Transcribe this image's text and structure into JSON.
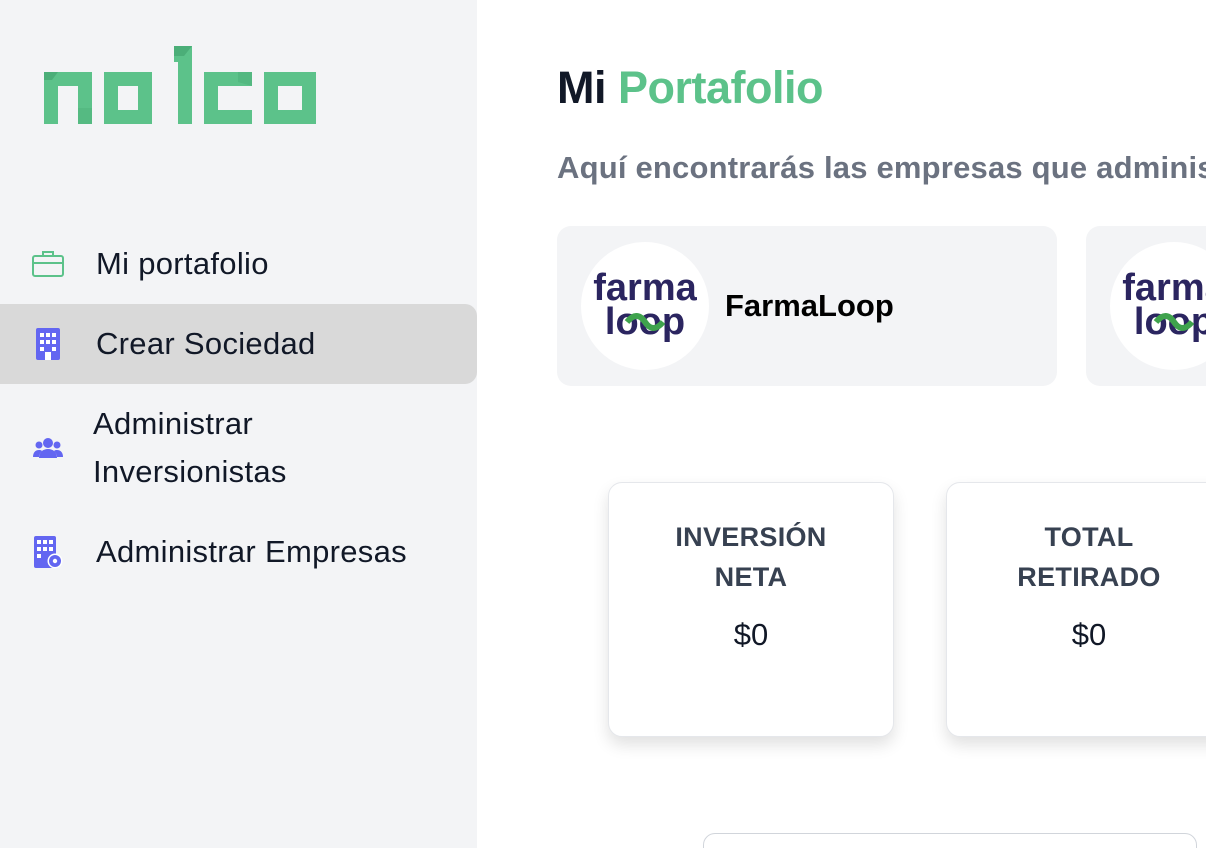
{
  "app": {
    "logo_text": "nolco",
    "brand_color": "#5cc28a",
    "icon_color": "#6366f1"
  },
  "sidebar": {
    "items": [
      {
        "label": "Mi portafolio",
        "icon": "briefcase-icon",
        "active": false
      },
      {
        "label": "Crear Sociedad",
        "icon": "building-icon",
        "active": true
      },
      {
        "label": "Administrar Inversionistas",
        "icon": "users-icon",
        "active": false
      },
      {
        "label": "Administrar Empresas",
        "icon": "building-gear-icon",
        "active": false
      }
    ]
  },
  "main": {
    "title_prefix": "Mi",
    "title_accent": "Portafolio",
    "subtitle": "Aquí encontrarás las empresas que adminis",
    "companies": [
      {
        "name": "FarmaLoop",
        "logo_text_top": "farma",
        "logo_text_bottom": "loop"
      },
      {
        "name": "",
        "logo_text_top": "farma",
        "logo_text_bottom": "loop"
      }
    ],
    "stats": [
      {
        "label": "INVERSIÓN NETA",
        "value": "$0"
      },
      {
        "label": "TOTAL RETIRADO",
        "value": "$0"
      }
    ]
  }
}
